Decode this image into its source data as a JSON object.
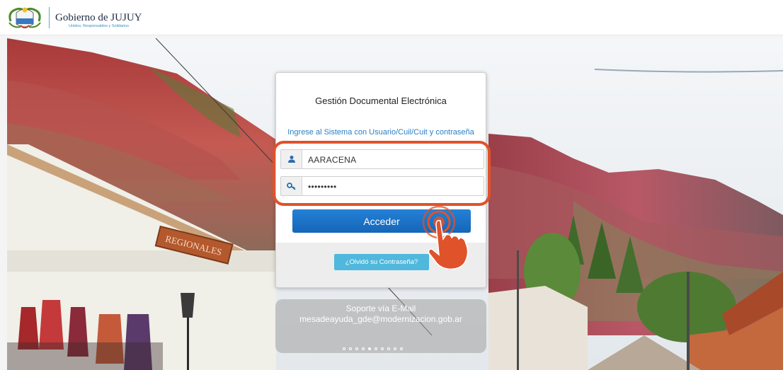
{
  "header": {
    "org_name": "Gobierno de JUJUY",
    "slogan": "Unidos, Responsables y Solidarios",
    "logo_icon": "coat-of-arms-icon"
  },
  "login": {
    "title": "Gestión Documental Electrónica",
    "subtitle": "Ingrese al Sistema con Usuario/Cuil/Cuit y contraseña",
    "username": {
      "value": "AARACENA",
      "icon": "user-icon"
    },
    "password": {
      "value": "•••••••••",
      "icon": "key-icon"
    },
    "submit_label": "Acceder",
    "forgot_label": "¿Olvidó su Contraseña?"
  },
  "support": {
    "line1": "Soporte vía E-Mail",
    "line2": "mesadeayuda_gde@modernizacion.gob.ar"
  },
  "carousel": {
    "total": 10,
    "active_index": 4
  },
  "colors": {
    "accent": "#1566b8",
    "highlight": "#e0522a",
    "link": "#2a7fc4",
    "forgot_button": "#4fb8dc"
  }
}
